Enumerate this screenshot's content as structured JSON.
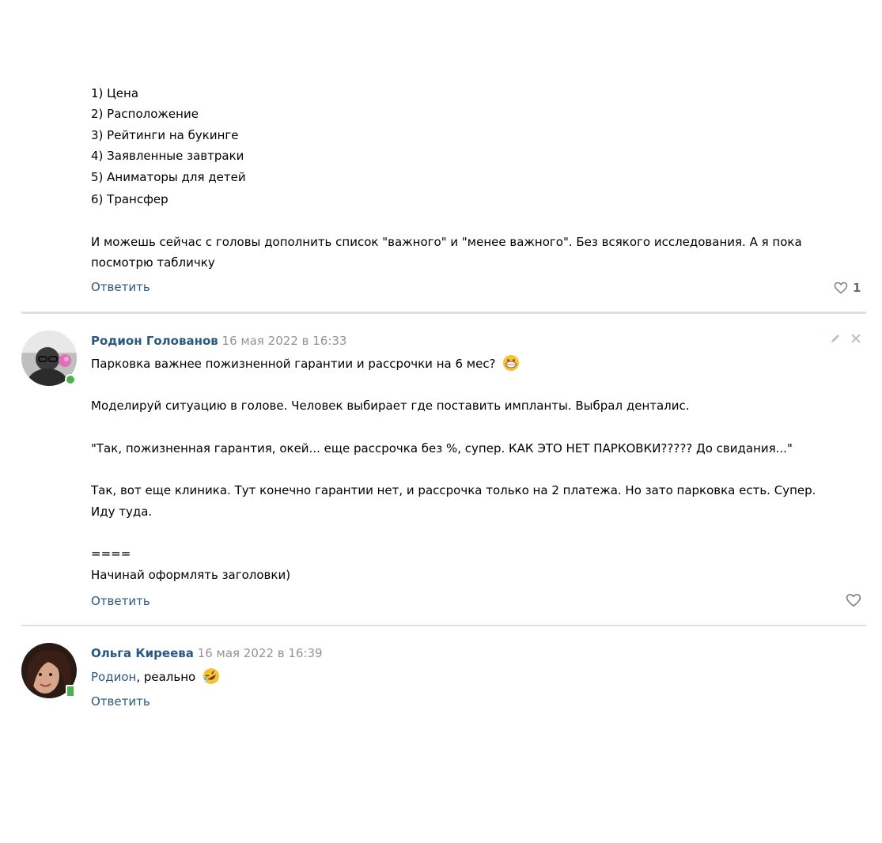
{
  "top_comment": {
    "list": [
      "1) Цена",
      "2) Расположение",
      "3) Рейтинги на букинге",
      "4) Заявленные завтраки",
      "5) Аниматоры для детей",
      "6) Трансфер"
    ],
    "para_line1": "И можешь сейчас с головы дополнить список \"важного\" и \"менее важного\". Без всякого исследования. А я пока",
    "para_line2": "посмотрю табличку",
    "reply_label": "Ответить",
    "like_count": "1"
  },
  "comment2": {
    "author": "Родион Голованов",
    "date": "16 мая 2022 в 16:33",
    "lines": [
      "Парковка важнее пожизненной гарантии и рассрочки на 6 мес?",
      "Моделируй ситуацию в голове. Человек выбирает где поставить импланты. Выбрал денталис.",
      "\"Так, пожизненная гарантия, окей... еще рассрочка без %, супер. КАК ЭТО НЕТ ПАРКОВКИ????? До свидания...\"",
      "Так, вот еще клиника. Тут конечно гарантии нет, и рассрочка только на 2 платежа. Но зато парковка есть. Супер.",
      "Иду туда.",
      "====",
      "Начинай оформлять заголовки)"
    ],
    "reply_label": "Ответить",
    "emoji": "grinning-face-emoji"
  },
  "comment3": {
    "author": "Ольга Киреева",
    "date": "16 мая 2022 в 16:39",
    "mention": "Родион",
    "text": ", реально",
    "reply_label": "Ответить",
    "emoji": "rolling-on-floor-laughing-emoji"
  },
  "colors": {
    "link": "#2a5885",
    "date": "#939393",
    "divider": "#dce1e6",
    "online": "#4bb34b"
  },
  "icons": [
    "heart-icon",
    "edit-icon",
    "close-icon",
    "online-indicator",
    "mobile-online-indicator"
  ]
}
